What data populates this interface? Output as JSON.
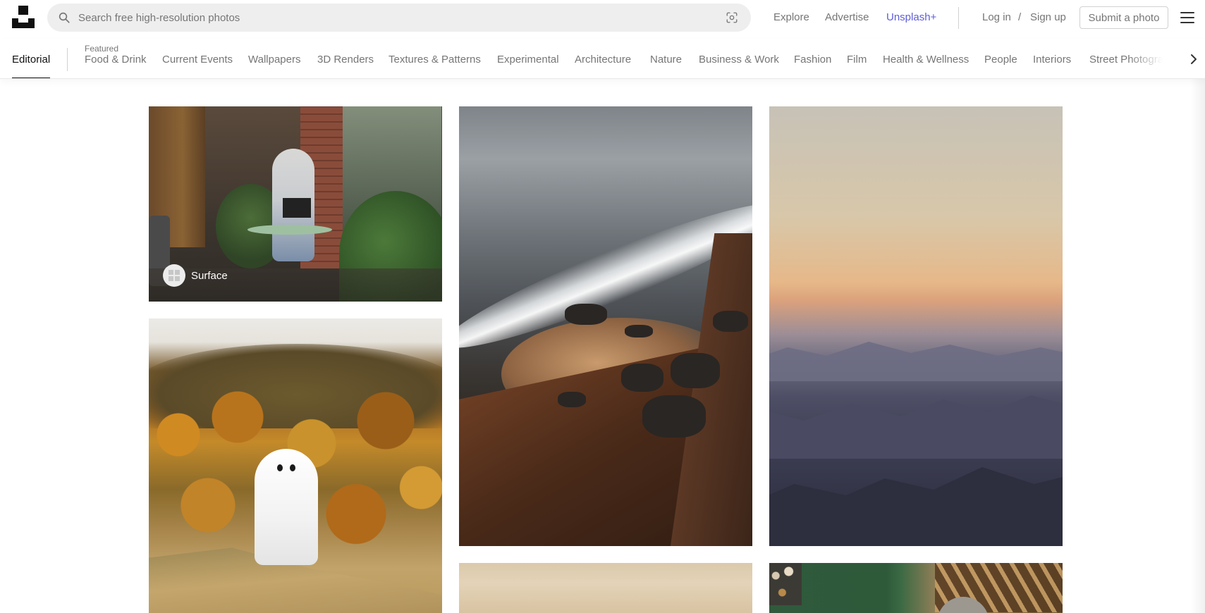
{
  "header": {
    "search_placeholder": "Search free high-resolution photos",
    "nav": {
      "explore": "Explore",
      "advertise": "Advertise",
      "unsplash_plus": "Unsplash+",
      "login": "Log in",
      "separator": "/",
      "signup": "Sign up",
      "submit": "Submit a photo"
    }
  },
  "categories": {
    "active_tab": "Editorial",
    "featured_label": "Featured",
    "items": [
      "Food & Drink",
      "Current Events",
      "Wallpapers",
      "3D Renders",
      "Textures & Patterns",
      "Experimental",
      "Architecture",
      "Nature",
      "Business & Work",
      "Fashion",
      "Film",
      "Health & Wellness",
      "People",
      "Interiors",
      "Street Photography"
    ]
  },
  "photos": {
    "first_author": "Surface"
  },
  "colors": {
    "accent": "#5d5ddb",
    "muted_text": "#767676",
    "primary_text": "#111111"
  },
  "icons": [
    "unsplash-logo-icon",
    "search-icon",
    "visual-search-icon",
    "menu-icon",
    "chevron-right-icon",
    "microsoft-logo-icon"
  ]
}
